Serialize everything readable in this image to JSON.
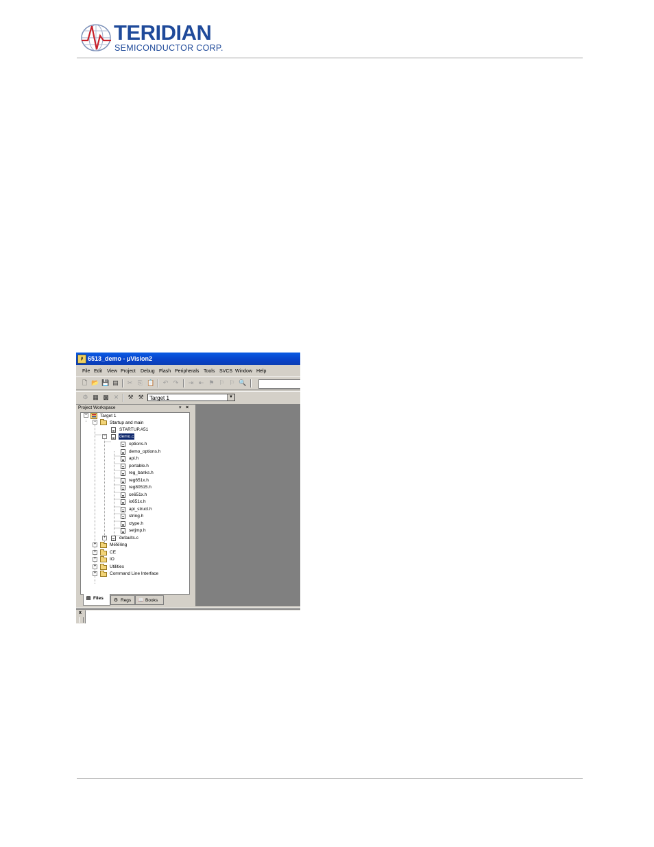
{
  "doc_header": {
    "brand": "TERIDIAN",
    "subtitle": "SEMICONDUCTOR CORP."
  },
  "app": {
    "title": "6513_demo - µVision2",
    "menu": [
      "File",
      "Edit",
      "View",
      "Project",
      "Debug",
      "Flash",
      "Peripherals",
      "Tools",
      "SVCS",
      "Window",
      "Help"
    ],
    "toolbar2": {
      "target_value": "Target 1"
    },
    "workspace": {
      "title": "Project Workspace",
      "tree": {
        "target": "Target 1",
        "startup_group": "Startup and main",
        "startup_file": "STARTUP.A51",
        "main_file": "demo.c",
        "headers": [
          "options.h",
          "demo_options.h",
          "api.h",
          "portable.h",
          "reg_banks.h",
          "reg651x.h",
          "reg80515.h",
          "ce651x.h",
          "io651x.h",
          "api_struct.h",
          "string.h",
          "ctype.h",
          "setjmp.h"
        ],
        "defaults_file": "defaults.c",
        "groups": [
          "Metering",
          "CE",
          "IO",
          "Utilities",
          "Command Line Interface"
        ]
      },
      "tabs": [
        "Files",
        "Regs",
        "Books"
      ]
    },
    "output": {
      "close": "x"
    }
  },
  "colors": {
    "brand_blue": "#1f4a9a",
    "xp_titlebar": "#0a5ce4",
    "selection": "#0a246a",
    "mdi_gray": "#808080"
  }
}
